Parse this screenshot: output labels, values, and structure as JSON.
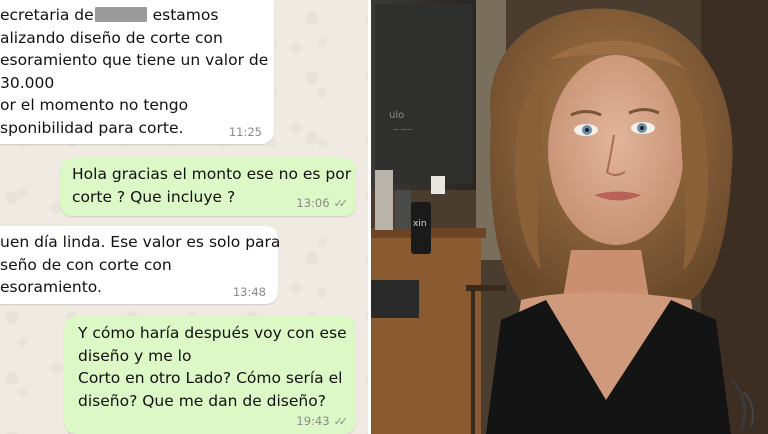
{
  "messages": {
    "m1": {
      "line1_before": "ecretaria de",
      "line1_after": " estamos",
      "line2": "alizando diseño de corte con",
      "line3": "esoramiento que tiene un valor de",
      "line4": "30.000",
      "line5": "or el momento no tengo",
      "line6": "sponibilidad para corte.",
      "time": "11:25"
    },
    "m2": {
      "text": "Hola gracias el monto ese no es por\ncorte ? Que incluye ?",
      "time": "13:06"
    },
    "m3": {
      "text": "uen día linda. Ese valor es solo para\nseño de con corte con\nesoramiento.",
      "time": "13:48"
    },
    "m4": {
      "text": "Y cómo haría después voy con ese\ndiseño y me lo\nCorto en otro Lado? Cómo sería el\ndiseño? Que me dan de diseño?",
      "time": "19:43"
    }
  },
  "photo": {
    "shirt_text": "xin"
  },
  "colors": {
    "chat_background": "#efeae2",
    "incoming_bubble": "#ffffff",
    "outgoing_bubble": "#dcf8c6"
  }
}
